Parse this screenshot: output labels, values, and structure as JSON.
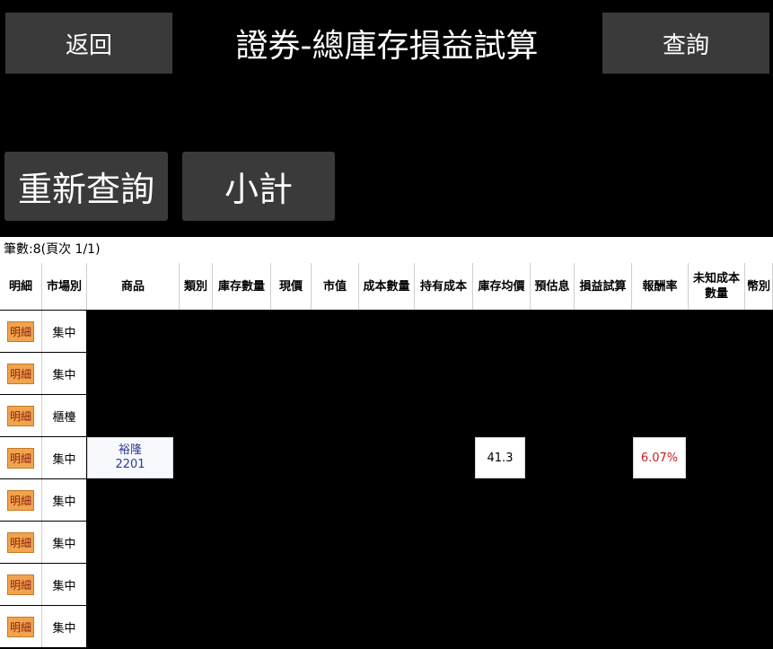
{
  "header": {
    "back_label": "返回",
    "title": "證券-總庫存損益試算",
    "query_label": "查詢"
  },
  "actions": {
    "requery_label": "重新查詢",
    "subtotal_label": "小計"
  },
  "info": {
    "record_text": "筆數:8(頁次 1/1)"
  },
  "table": {
    "columns": [
      "明細",
      "市場別",
      "商品",
      "類別",
      "庫存數量",
      "現價",
      "市值",
      "成本數量",
      "持有成本",
      "庫存均價",
      "預估息",
      "損益試算",
      "報酬率",
      "未知成本\n數量",
      "幣別"
    ],
    "detail_label": "明細",
    "rows": [
      {
        "market": "集中"
      },
      {
        "market": "集中"
      },
      {
        "market": "櫃檯"
      },
      {
        "market": "集中",
        "product_name": "裕隆",
        "product_code": "2201",
        "avg_price": "41.3",
        "return_rate": "6.07%"
      },
      {
        "market": "集中"
      },
      {
        "market": "集中"
      },
      {
        "market": "集中"
      },
      {
        "market": "集中"
      }
    ]
  },
  "colors": {
    "background": "#000000",
    "button": "#3a3a3a",
    "detail_button": "#f0a44d",
    "negative_red": "#c81e1e",
    "product_blue": "#2a3a9a"
  }
}
